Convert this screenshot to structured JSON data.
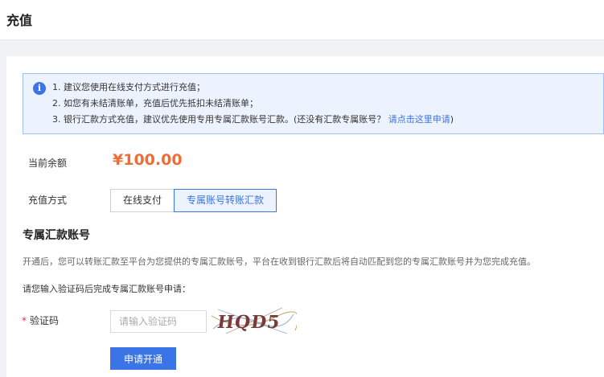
{
  "header": {
    "title": "充值"
  },
  "notice": {
    "line1": "1. 建议您使用在线支付方式进行充值；",
    "line2": "2. 如您有未结清账单，充值后优先抵扣未结清账单；",
    "line3_text": "3. 银行汇款方式充值，建议优先使用专用专属汇款账号汇款。(还没有汇款专属账号？",
    "line3_link": "请点击这里申请",
    "line3_tail": ")"
  },
  "balance": {
    "label": "当前余额",
    "value": "¥100.00"
  },
  "method": {
    "label": "充值方式",
    "options": [
      "在线支付",
      "专属账号转账汇款"
    ],
    "selected": "专属账号转账汇款"
  },
  "section": {
    "title": "专属汇款账号",
    "description": "开通后，您可以转账汇款至平台为您提供的专属汇款账号，平台在收到银行汇款后将自动匹配到您的专属汇款账号并为您完成充值。",
    "prompt": "请您输入验证码后完成专属汇款账号申请："
  },
  "captcha": {
    "required_mark": "*",
    "label": "验证码",
    "placeholder": "请输入验证码",
    "value": "",
    "image_text": "HQD5"
  },
  "submit": {
    "label": "申请开通"
  },
  "colors": {
    "accent": "#3a74e6",
    "balance": "#ef6c35",
    "required": "#e5323e"
  }
}
